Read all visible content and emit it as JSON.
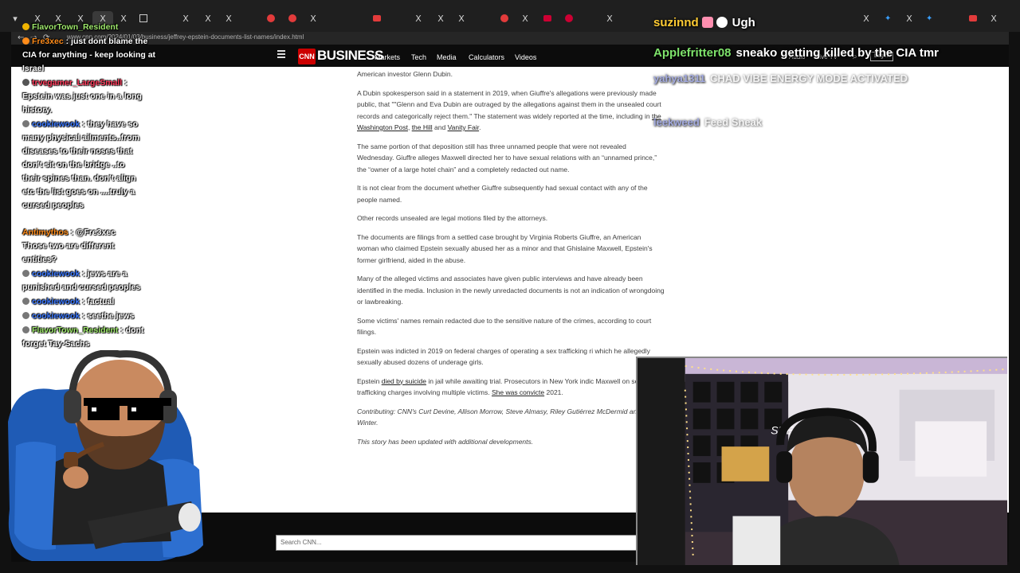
{
  "browser": {
    "tab_glyphs": [
      "X",
      "X",
      "X",
      "X",
      "X",
      "X",
      "X",
      "X",
      "X",
      "X",
      "X",
      "X",
      "X",
      "X",
      "X",
      "X",
      "X",
      "X"
    ],
    "address_url": "www.cnn.com/2024/01/03/business/jeffrey-epstein-documents-list-names/index.html",
    "back_glyph": "←",
    "forward_glyph": "→",
    "reload_glyph": "⟳"
  },
  "cnn_header": {
    "logo": "CNN",
    "section": "BUSINESS",
    "nav": [
      "Markets",
      "Tech",
      "Media",
      "Calculators",
      "Videos"
    ],
    "right_nav": [
      "Audio",
      "Live TV"
    ],
    "login": "Log In"
  },
  "article": {
    "p1": "American investor Glenn Dubin.",
    "p2a": "A Dubin spokesperson said in a statement in 2019, when Giuffre's allegations were previously made public, that \"\"Glenn and Eva Dubin are outraged by the allegations against them in the unsealed court records and categorically reject them.\" The statement was widely reported at the time, including in ",
    "p2_link1": "the Washington Post",
    "p2_sep": ", ",
    "p2_link2": "the Hill",
    "p2b": " and ",
    "p2_link3": "Vanity Fair",
    "p2c": ".",
    "p3": "The same portion of that deposition still has three unnamed people that were not revealed Wednesday. Giuffre alleges Maxwell directed her to have sexual relations with an “unnamed prince,” the “owner of a large hotel chain” and a completely redacted out name.",
    "p4": "It is not clear from the document whether Giuffre subsequently had sexual contact with any of the people named.",
    "p5": "Other records unsealed are legal motions filed by the attorneys.",
    "p6": "The documents are filings from a settled case brought by Virginia Roberts Giuffre, an American woman who claimed Epstein sexually abused her as a minor and that Ghislaine Maxwell, Epstein's former girlfriend, aided in the abuse.",
    "p7": "Many of the alleged victims and associates have given public interviews and have already been identified in the media. Inclusion in the newly unredacted documents is not an indication of wrongdoing or lawbreaking.",
    "p8": "Some victims' names remain redacted due to the sensitive nature of the crimes, according to court filings.",
    "p9": "Epstein was indicted in 2019 on federal charges of operating a sex trafficking ri which he allegedly sexually abused dozens of underage girls.",
    "p10a": "Epstein ",
    "p10_link1": "died by suicide",
    "p10b": " in jail while awaiting trial. Prosecutors in New York indic Maxwell on sex trafficking charges involving multiple victims. ",
    "p10_link2": "She was convicte",
    "p10c": " 2021.",
    "p11": "Contributing: CNN's Curt Devine, Allison Morrow, Steve Almasy, Riley Gutiérrez McDermid and Jeff Winter.",
    "p12": "This story has been updated with additional developments."
  },
  "footer": {
    "search_placeholder": "Search CNN..."
  },
  "chat": [
    {
      "name": "FlavorTown_Resident",
      "name_color": "#9ee86b",
      "msg": " : just dont blame the CIA for anything - keep looking at Israel",
      "badge_color": "#f0b400"
    },
    {
      "name": "trvegamer_LargeSmall",
      "name_color": "#ff3b5c",
      "msg": " : Epstein was just one in a long history.",
      "badge_color": "#555"
    },
    {
      "name": "cookiewook",
      "name_color": "#3a78ff",
      "msg": " : they have so many physical ailments..from diseases to their noses that don't sit on the bridge ..to their spines than. don't align etc the list goes on ....truly a cursed peoples",
      "badge_color": "#888"
    },
    {
      "name": "Antimythos",
      "name_color": "#ff8c1a",
      "msg": " : @Fre3xec Those two are different entities?",
      "badge_color": ""
    },
    {
      "name": "cookiewook",
      "name_color": "#3a78ff",
      "msg": " : jews are a punished and cursed peoples",
      "badge_color": "#888"
    },
    {
      "name": "cookiewook",
      "name_color": "#3a78ff",
      "msg": " : factual",
      "badge_color": "#888"
    },
    {
      "name": "cookiewook",
      "name_color": "#3a78ff",
      "msg": " : seethe jews",
      "badge_color": "#888"
    },
    {
      "name": "FlavorTown_Resident",
      "name_color": "#9ee86b",
      "msg": " : dont forget Tay-Sachs",
      "badge_color": "#888"
    }
  ],
  "chat_header": {
    "name": "Fre3xec",
    "name_color": "#ff8c1a"
  },
  "overlay_chat": [
    {
      "name": "suzinnd",
      "name_color": "#ffcc33",
      "msg": "Ugh"
    },
    {
      "name": "Applefritter08",
      "name_color": "#7ee36b",
      "msg": "sneako getting killed by the CIA tmr"
    },
    {
      "name": "yahya1311",
      "name_color": "#7a86d8",
      "msg": "CHAD VIBE ENERGY MODE ACTIVATED"
    },
    {
      "name": "leekweed",
      "name_color": "#7a86d8",
      "msg": "Feed Sneak"
    }
  ],
  "webcam": {
    "neon_sign": "SNEAKO"
  }
}
